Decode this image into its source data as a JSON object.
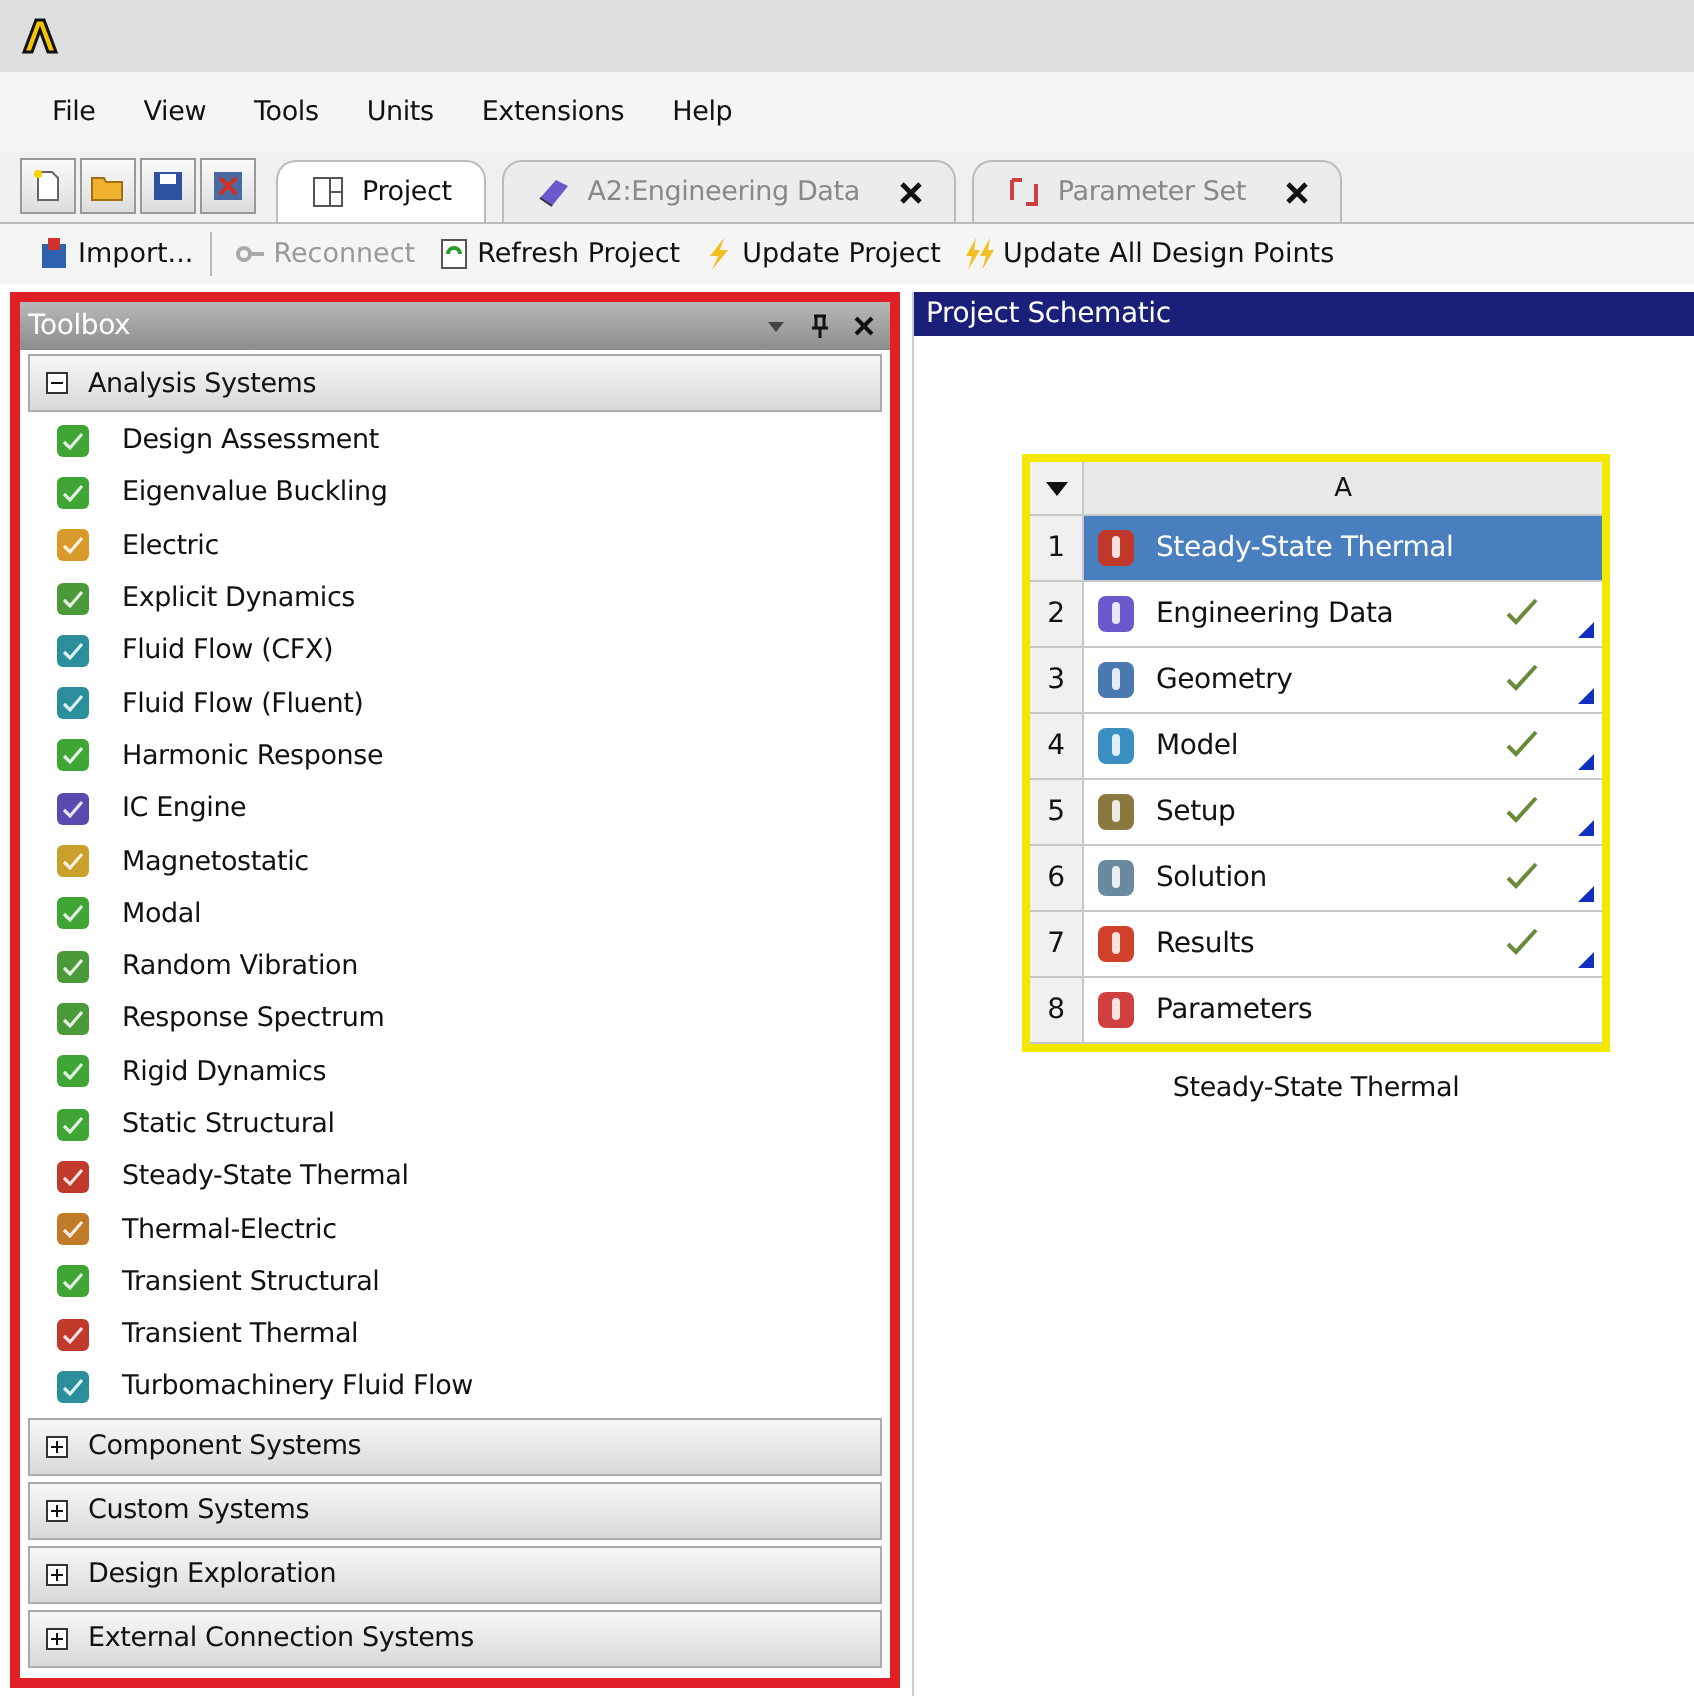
{
  "menu": [
    "File",
    "View",
    "Tools",
    "Units",
    "Extensions",
    "Help"
  ],
  "tabs": [
    {
      "label": "Project",
      "selected": true,
      "closable": false
    },
    {
      "label": "A2:Engineering Data",
      "selected": false,
      "closable": true
    },
    {
      "label": "Parameter Set",
      "selected": false,
      "closable": true
    }
  ],
  "toolbar": [
    {
      "label": "Import...",
      "disabled": false
    },
    {
      "label": "Reconnect",
      "disabled": true
    },
    {
      "label": "Refresh Project",
      "disabled": false
    },
    {
      "label": "Update Project",
      "disabled": false
    },
    {
      "label": "Update All Design Points",
      "disabled": false
    }
  ],
  "toolbox": {
    "title": "Toolbox",
    "categories": [
      {
        "label": "Analysis Systems",
        "expanded": true,
        "items": [
          "Design Assessment",
          "Eigenvalue Buckling",
          "Electric",
          "Explicit Dynamics",
          "Fluid Flow (CFX)",
          "Fluid Flow (Fluent)",
          "Harmonic Response",
          "IC Engine",
          "Magnetostatic",
          "Modal",
          "Random Vibration",
          "Response Spectrum",
          "Rigid Dynamics",
          "Static Structural",
          "Steady-State Thermal",
          "Thermal-Electric",
          "Transient Structural",
          "Transient Thermal",
          "Turbomachinery Fluid Flow"
        ]
      },
      {
        "label": "Component Systems",
        "expanded": false
      },
      {
        "label": "Custom Systems",
        "expanded": false
      },
      {
        "label": "Design Exploration",
        "expanded": false
      },
      {
        "label": "External Connection Systems",
        "expanded": false
      }
    ]
  },
  "schematic": {
    "title": "Project Schematic",
    "system": {
      "column": "A",
      "caption": "Steady-State Thermal",
      "rows": [
        {
          "number": "1",
          "label": "Steady-State Thermal",
          "selected": true,
          "checked": false
        },
        {
          "number": "2",
          "label": "Engineering Data",
          "selected": false,
          "checked": true
        },
        {
          "number": "3",
          "label": "Geometry",
          "selected": false,
          "checked": true
        },
        {
          "number": "4",
          "label": "Model",
          "selected": false,
          "checked": true
        },
        {
          "number": "5",
          "label": "Setup",
          "selected": false,
          "checked": true
        },
        {
          "number": "6",
          "label": "Solution",
          "selected": false,
          "checked": true
        },
        {
          "number": "7",
          "label": "Results",
          "selected": false,
          "checked": true
        },
        {
          "number": "8",
          "label": "Parameters",
          "selected": false,
          "checked": false
        }
      ]
    }
  }
}
